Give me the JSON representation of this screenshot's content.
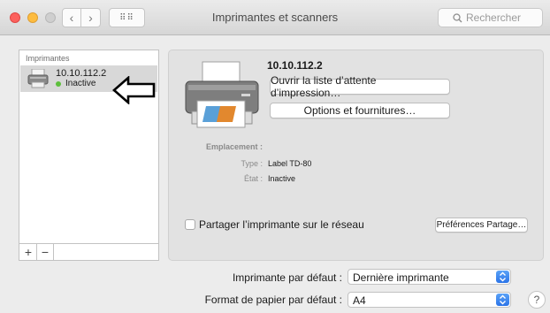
{
  "window": {
    "title": "Imprimantes et scanners",
    "search_placeholder": "Rechercher",
    "nav": {
      "back_glyph": "‹",
      "forward_glyph": "›",
      "grid_glyph": "⠿⠿"
    }
  },
  "sidebar": {
    "header": "Imprimantes",
    "items": [
      {
        "name": "10.10.112.2",
        "status": "Inactive",
        "status_color": "#5dbf3c",
        "icon": "printer-icon"
      }
    ],
    "add_label": "+",
    "remove_label": "−"
  },
  "detail": {
    "printer_name": "10.10.112.2",
    "open_queue_label": "Ouvrir la liste d’attente d’impression…",
    "options_label": "Options et fournitures…",
    "location_label": "Emplacement :",
    "location_value": "",
    "type_label": "Type :",
    "type_value": "Label TD-80",
    "state_label": "État :",
    "state_value": "Inactive",
    "share_label": "Partager l’imprimante sur le réseau",
    "share_prefs_label": "Préférences Partage…"
  },
  "settings": {
    "default_printer_label": "Imprimante par défaut :",
    "default_printer_value": "Dernière imprimante",
    "paper_label": "Format de papier par défaut :",
    "paper_value": "A4",
    "help_label": "?"
  },
  "colors": {
    "accent": "#2b74e8",
    "selection": "#d8d8d8",
    "status_idle": "#5dbf3c"
  }
}
